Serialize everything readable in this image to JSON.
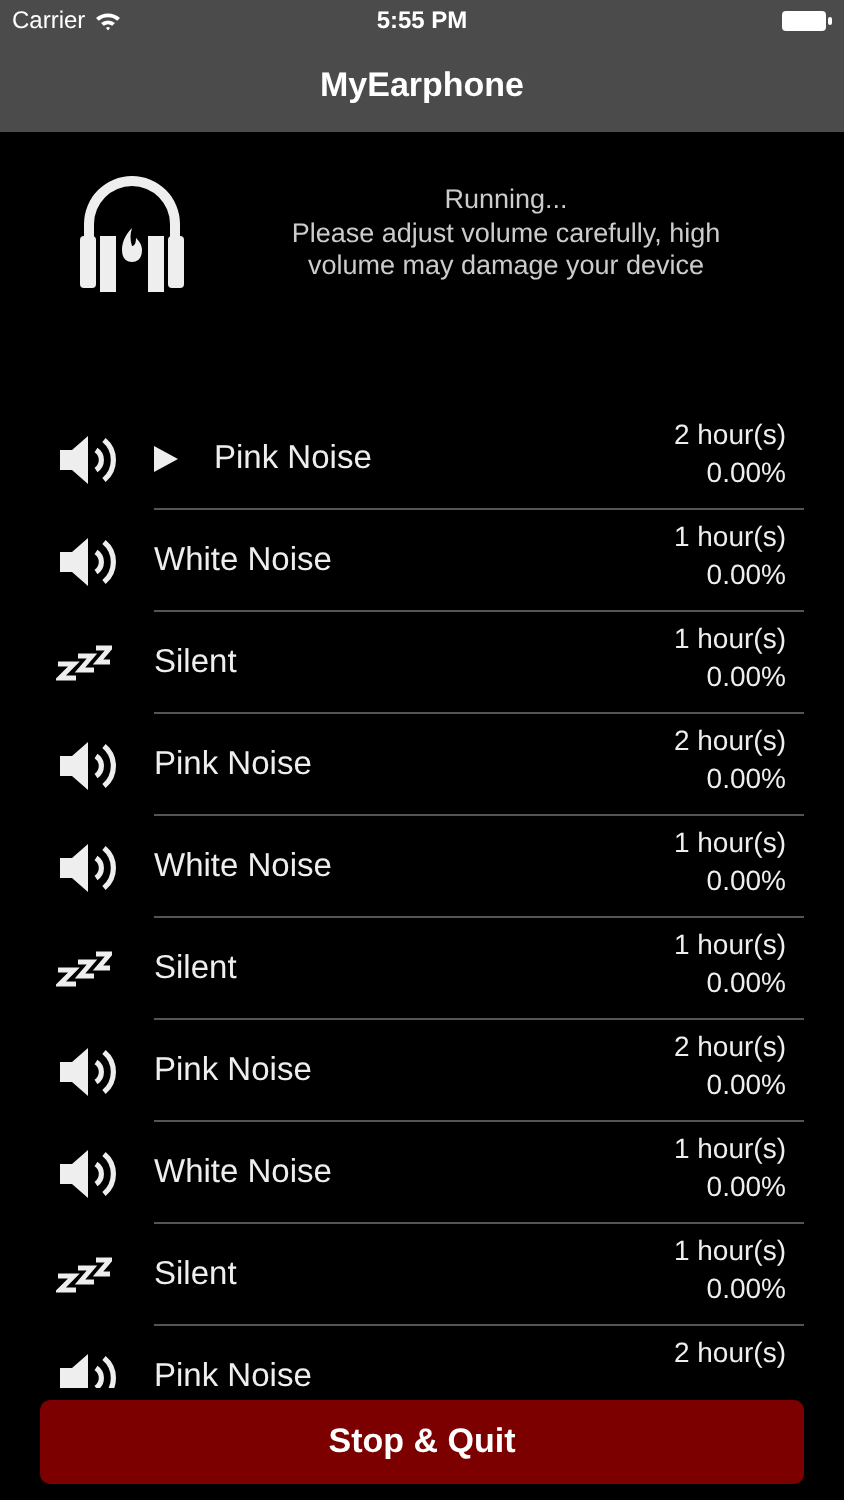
{
  "status_bar": {
    "carrier": "Carrier",
    "time": "5:55 PM"
  },
  "nav_bar": {
    "title": "MyEarphone"
  },
  "status_message": {
    "state": "Running...",
    "warning": "Please adjust volume carefully, high volume may damage your device"
  },
  "tracks": [
    {
      "kind": "sound",
      "playing": true,
      "name": "Pink Noise",
      "duration": "2 hour(s)",
      "progress": "0.00%"
    },
    {
      "kind": "sound",
      "playing": false,
      "name": "White Noise",
      "duration": "1 hour(s)",
      "progress": "0.00%"
    },
    {
      "kind": "silent",
      "playing": false,
      "name": "Silent",
      "duration": "1 hour(s)",
      "progress": "0.00%"
    },
    {
      "kind": "sound",
      "playing": false,
      "name": "Pink Noise",
      "duration": "2 hour(s)",
      "progress": "0.00%"
    },
    {
      "kind": "sound",
      "playing": false,
      "name": "White Noise",
      "duration": "1 hour(s)",
      "progress": "0.00%"
    },
    {
      "kind": "silent",
      "playing": false,
      "name": "Silent",
      "duration": "1 hour(s)",
      "progress": "0.00%"
    },
    {
      "kind": "sound",
      "playing": false,
      "name": "Pink Noise",
      "duration": "2 hour(s)",
      "progress": "0.00%"
    },
    {
      "kind": "sound",
      "playing": false,
      "name": "White Noise",
      "duration": "1 hour(s)",
      "progress": "0.00%"
    },
    {
      "kind": "silent",
      "playing": false,
      "name": "Silent",
      "duration": "1 hour(s)",
      "progress": "0.00%"
    },
    {
      "kind": "sound",
      "playing": false,
      "name": "Pink Noise",
      "duration": "2 hour(s)"
    }
  ],
  "stop_button": {
    "label": "Stop & Quit"
  }
}
